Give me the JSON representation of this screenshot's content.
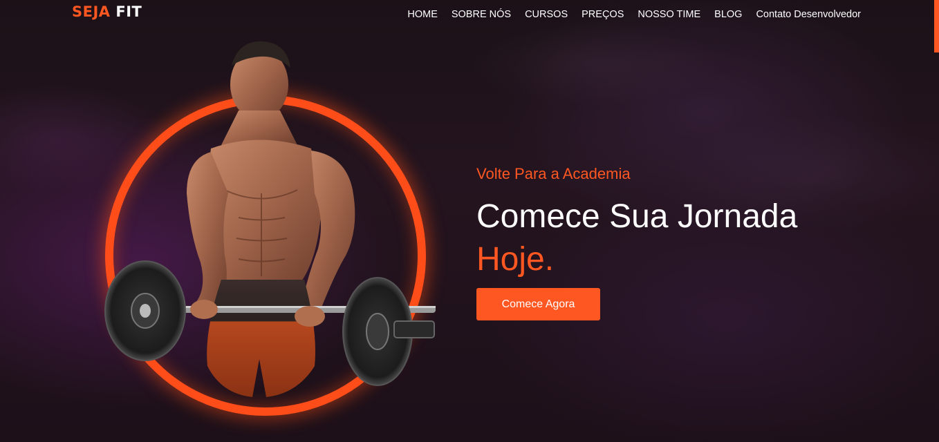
{
  "brand": {
    "part1": "SEJA",
    "part2": "FIT"
  },
  "nav": {
    "items": [
      "HOME",
      "SOBRE NÓS",
      "CURSOS",
      "PREÇOS",
      "NOSSO TIME",
      "BLOG",
      "Contato Desenvolvedor"
    ]
  },
  "hero": {
    "subtitle": "Volte Para a Academia",
    "heading_line1": "Comece Sua Jornada",
    "heading_line2": "Hoje.",
    "cta_label": "Comece Agora"
  },
  "icons": {
    "hero_image": "athlete-barbell-image"
  },
  "colors": {
    "accent": "#ff5722",
    "background": "#1a1018",
    "text": "#ffffff"
  }
}
